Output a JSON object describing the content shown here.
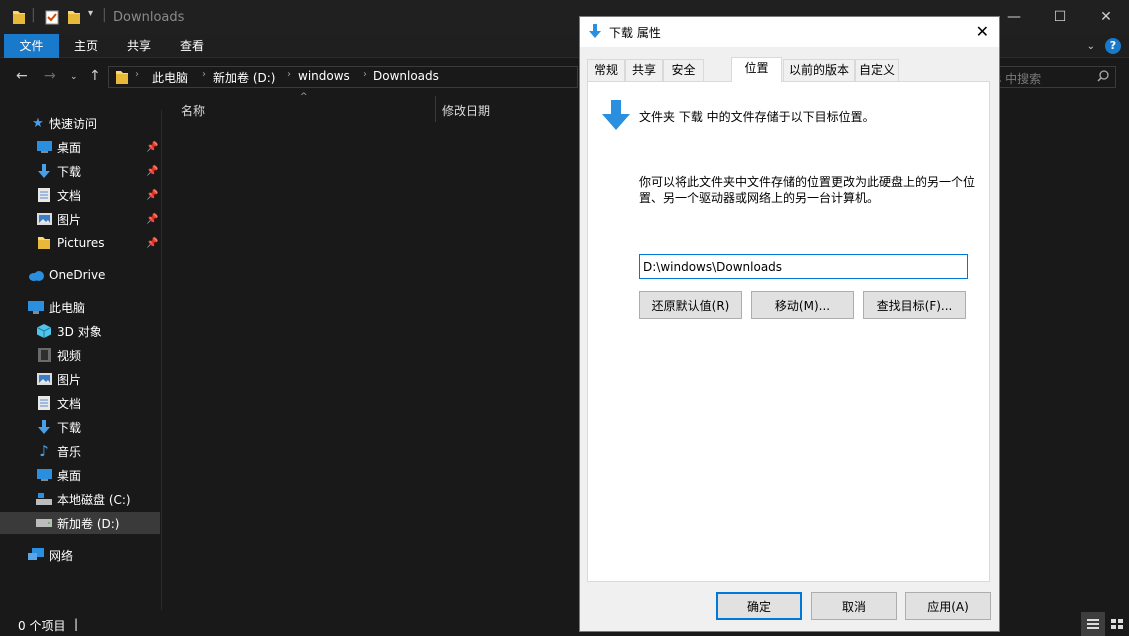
{
  "explorer": {
    "title": "Downloads",
    "ribbon_tabs": [
      "文件",
      "主页",
      "共享",
      "查看"
    ],
    "address": [
      "此电脑",
      "新加卷 (D:)",
      "windows",
      "Downloads"
    ],
    "search_placeholder": "s 中搜索",
    "columns": [
      "名称",
      "修改日期"
    ],
    "nav": {
      "quick_access": "快速访问",
      "quick_items": [
        "桌面",
        "下载",
        "文档",
        "图片",
        "Pictures"
      ],
      "onedrive": "OneDrive",
      "this_pc": "此电脑",
      "pc_items": [
        "3D 对象",
        "视频",
        "图片",
        "文档",
        "下载",
        "音乐",
        "桌面",
        "本地磁盘 (C:)",
        "新加卷 (D:)"
      ],
      "network": "网络"
    },
    "status": "0 个项目",
    "status_sep": "|",
    "accent_color": "#1979ca"
  },
  "dialog": {
    "title": "下载 属性",
    "tabs": [
      "常规",
      "共享",
      "安全",
      "位置",
      "以前的版本",
      "自定义"
    ],
    "active_tab": "位置",
    "line1": "文件夹 下载 中的文件存储于以下目标位置。",
    "desc": "你可以将此文件夹中文件存储的位置更改为此硬盘上的另一个位置、另一个驱动器或网络上的另一台计算机。",
    "path_value": "D:\\windows\\Downloads",
    "btn_restore": "还原默认值(R)",
    "btn_move": "移动(M)...",
    "btn_find": "查找目标(F)...",
    "btn_ok": "确定",
    "btn_cancel": "取消",
    "btn_apply": "应用(A)"
  }
}
